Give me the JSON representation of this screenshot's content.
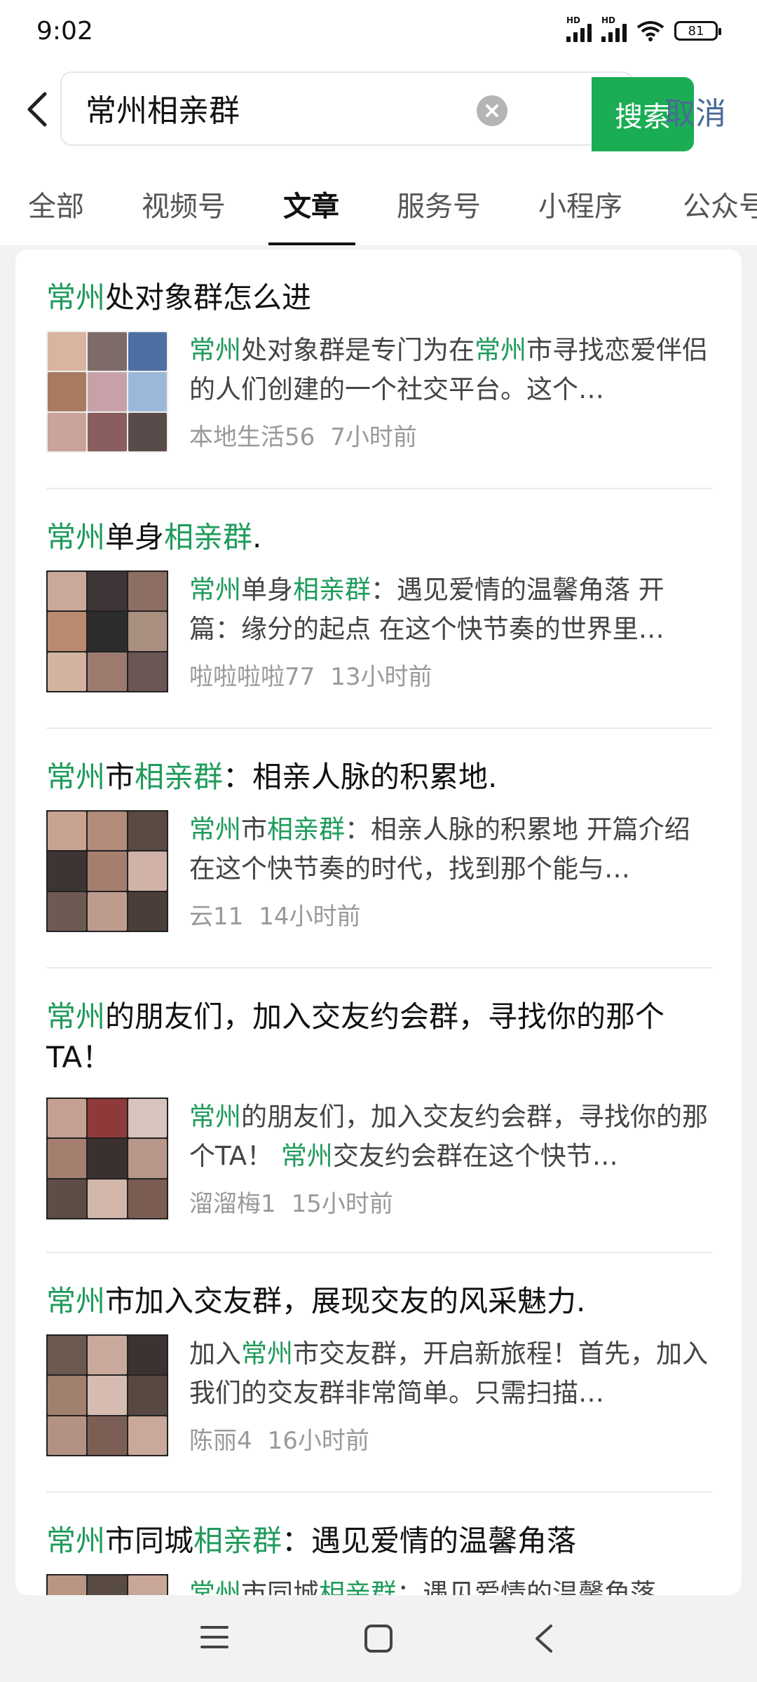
{
  "status": {
    "time": "9:02",
    "hd1": "HD",
    "hd2": "HD",
    "battery": "81"
  },
  "search": {
    "query": "常州相亲群",
    "button": "搜索",
    "cancel": "取消"
  },
  "tabs": [
    "全部",
    "视频号",
    "文章",
    "服务号",
    "小程序",
    "公众号"
  ],
  "results": [
    {
      "title": [
        {
          "t": "常州",
          "h": true
        },
        {
          "t": "处对象群怎么进",
          "h": false
        }
      ],
      "summary": [
        {
          "t": "常州",
          "h": true
        },
        {
          "t": "处对象群是专门为在",
          "h": false
        },
        {
          "t": "常州",
          "h": true
        },
        {
          "t": "市寻找恋爱伴侣的人们创建的一个社交平台。这个…",
          "h": false
        }
      ],
      "author": "本地生活56",
      "time": "7小时前"
    },
    {
      "title": [
        {
          "t": "常州",
          "h": true
        },
        {
          "t": "单身",
          "h": false
        },
        {
          "t": "相亲群",
          "h": true
        },
        {
          "t": ".",
          "h": false
        }
      ],
      "summary": [
        {
          "t": "常州",
          "h": true
        },
        {
          "t": "单身",
          "h": false
        },
        {
          "t": "相亲群",
          "h": true
        },
        {
          "t": "：遇见爱情的温馨角落 开篇：缘分的起点 在这个快节奏的世界里…",
          "h": false
        }
      ],
      "author": "啦啦啦啦77",
      "time": "13小时前"
    },
    {
      "title": [
        {
          "t": "常州",
          "h": true
        },
        {
          "t": "市",
          "h": false
        },
        {
          "t": "相亲群",
          "h": true
        },
        {
          "t": "：相亲人脉的积累地.",
          "h": false
        }
      ],
      "summary": [
        {
          "t": "常州",
          "h": true
        },
        {
          "t": "市",
          "h": false
        },
        {
          "t": "相亲群",
          "h": true
        },
        {
          "t": "：相亲人脉的积累地 开篇介绍 在这个快节奏的时代，找到那个能与…",
          "h": false
        }
      ],
      "author": "云11",
      "time": "14小时前"
    },
    {
      "title": [
        {
          "t": "常州",
          "h": true
        },
        {
          "t": "的朋友们，加入交友约会群，寻找你的那个TA！",
          "h": false
        }
      ],
      "summary": [
        {
          "t": "常州",
          "h": true
        },
        {
          "t": "的朋友们，加入交友约会群，寻找你的那个TA！ ",
          "h": false
        },
        {
          "t": "常州",
          "h": true
        },
        {
          "t": "交友约会群在这个快节…",
          "h": false
        }
      ],
      "author": "溜溜梅1",
      "time": "15小时前"
    },
    {
      "title": [
        {
          "t": "常州",
          "h": true
        },
        {
          "t": "市加入交友群，展现交友的风采魅力.",
          "h": false
        }
      ],
      "summary": [
        {
          "t": "加入",
          "h": false
        },
        {
          "t": "常州",
          "h": true
        },
        {
          "t": "市交友群，开启新旅程！首先，加入我们的交友群非常简单。只需扫描…",
          "h": false
        }
      ],
      "author": "陈丽4",
      "time": "16小时前"
    },
    {
      "title": [
        {
          "t": "常州",
          "h": true
        },
        {
          "t": "市同城",
          "h": false
        },
        {
          "t": "相亲群",
          "h": true
        },
        {
          "t": "：遇见爱情的温馨角落",
          "h": false
        }
      ],
      "summary": [
        {
          "t": "常州",
          "h": true
        },
        {
          "t": "市同城",
          "h": false
        },
        {
          "t": "相亲群",
          "h": true
        },
        {
          "t": "：遇见爱情的温馨角落",
          "h": false
        }
      ],
      "author": "",
      "time": ""
    }
  ],
  "colors": {
    "accent_green": "#1aad54",
    "highlight_green": "#1e9b5a",
    "cancel_blue": "#4a6b95"
  },
  "icons": {
    "back": "chevron-left-icon",
    "clear": "clear-circle-icon",
    "menu": "menu-icon",
    "home": "home-square-icon",
    "nav_back": "nav-back-icon"
  }
}
